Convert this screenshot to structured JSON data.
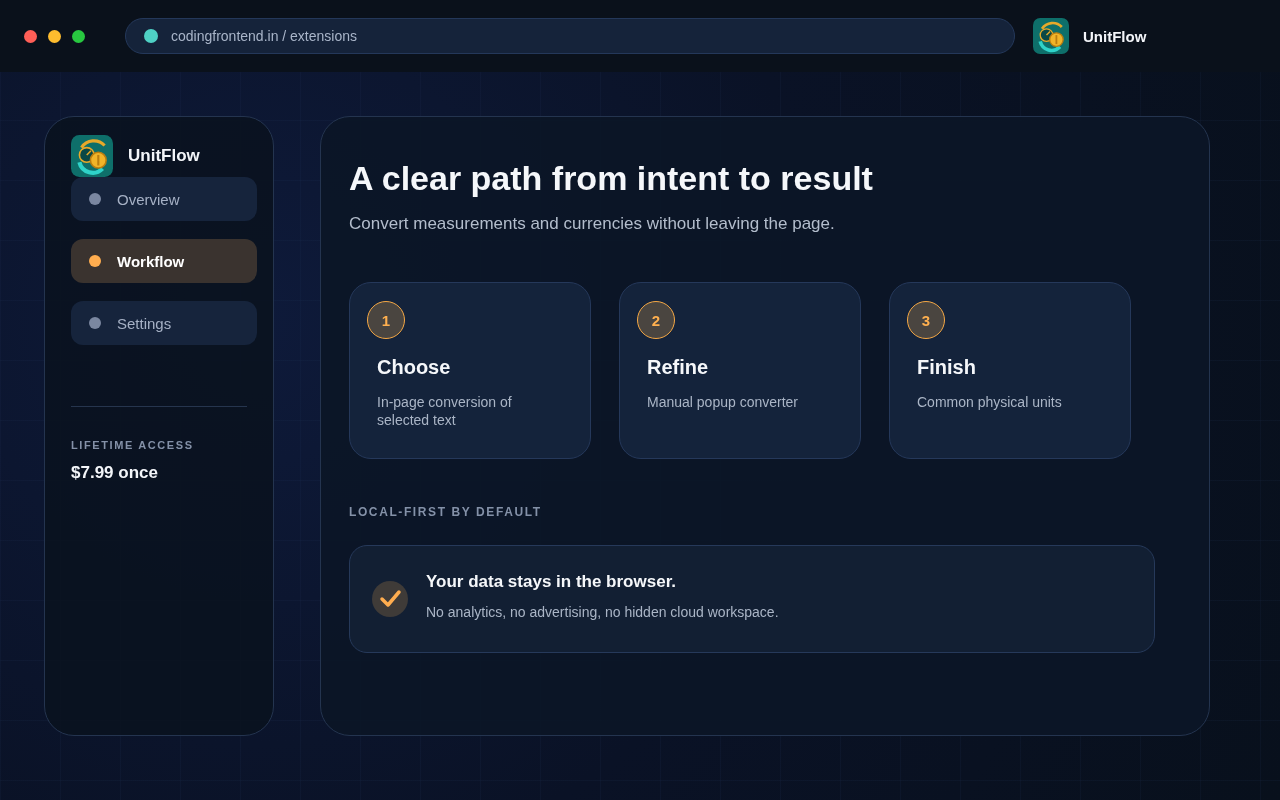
{
  "browser": {
    "address": "codingfrontend.in / extensions",
    "app_name": "UnitFlow"
  },
  "sidebar": {
    "app_name": "UnitFlow",
    "items": [
      {
        "label": "Overview",
        "selected": false
      },
      {
        "label": "Workflow",
        "selected": true
      },
      {
        "label": "Settings",
        "selected": false
      }
    ],
    "plan_label": "LIFETIME ACCESS",
    "price": "$7.99 once"
  },
  "main": {
    "title": "A clear path from intent to result",
    "subtitle": "Convert measurements and currencies without leaving the page.",
    "steps": [
      {
        "number": "1",
        "title": "Choose",
        "description": "In-page conversion of selected text"
      },
      {
        "number": "2",
        "title": "Refine",
        "description": "Manual popup converter"
      },
      {
        "number": "3",
        "title": "Finish",
        "description": "Common physical units"
      }
    ],
    "section_label": "LOCAL-FIRST BY DEFAULT",
    "notice": {
      "title": "Your data stays in the browser.",
      "text": "No analytics, no advertising, no hidden cloud workspace.",
      "checked": true
    }
  }
}
